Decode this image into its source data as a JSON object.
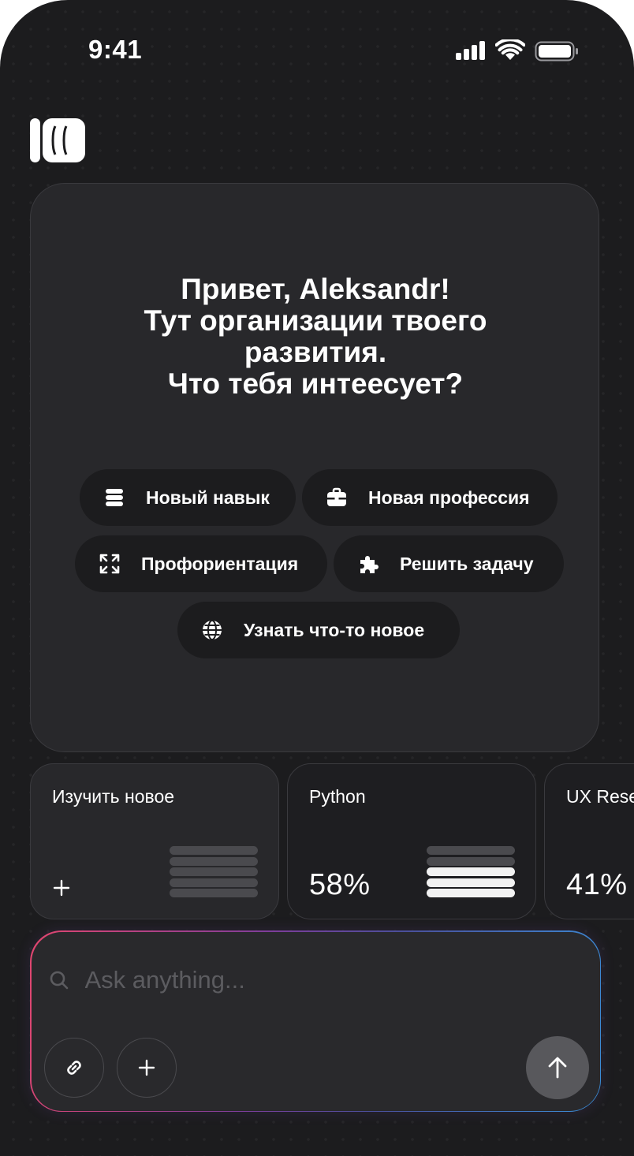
{
  "status_bar": {
    "time": "9:41",
    "icons": [
      "cellular-signal-icon",
      "wifi-icon",
      "battery-icon"
    ]
  },
  "brand": {
    "logo": "app-logo"
  },
  "hero": {
    "title_lines": [
      "Привет, Aleksandr!",
      "Тут организации твоего",
      "развития.",
      "Что тебя интеесует?"
    ],
    "chips": [
      {
        "label": "Новый навык",
        "icon": "layers-icon"
      },
      {
        "label": "Новая профессия",
        "icon": "briefcase-icon"
      },
      {
        "label": "Профориентация",
        "icon": "expand-icon"
      },
      {
        "label": "Решить задачу",
        "icon": "puzzle-icon"
      },
      {
        "label": "Узнать что-то новое",
        "icon": "globe-icon"
      }
    ]
  },
  "cards": [
    {
      "title": "Изучить новое",
      "value": "",
      "action": "+",
      "bars_filled": 0,
      "bars_total": 5
    },
    {
      "title": "Python",
      "value": "58%",
      "bars_filled": 3,
      "bars_total": 5
    },
    {
      "title": "UX Rese",
      "value": "41%",
      "bars_filled": 2,
      "bars_total": 5
    }
  ],
  "prompt": {
    "placeholder": "Ask anything...",
    "value": "",
    "buttons": [
      "attach-icon",
      "plus-icon",
      "arrow-up-icon"
    ]
  },
  "colors": {
    "background": "#1c1c1e",
    "panel": "#28282b",
    "chip": "#1c1c1e",
    "text": "#ffffff",
    "placeholder": "#5c5c60",
    "send_button": "#58585c",
    "gradient": [
      "#e2466f",
      "#7d3d9a",
      "#3a8ed8"
    ]
  }
}
